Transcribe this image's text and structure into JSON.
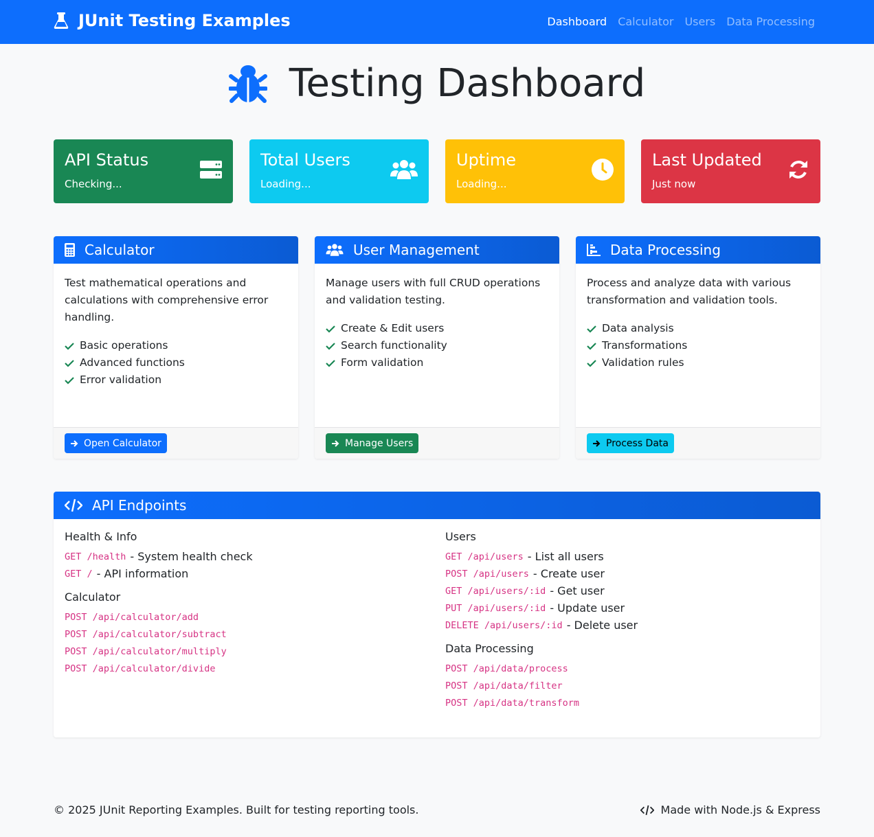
{
  "nav": {
    "brand": "JUnit Testing Examples",
    "links": [
      "Dashboard",
      "Calculator",
      "Users",
      "Data Processing"
    ]
  },
  "page": {
    "title": "Testing Dashboard"
  },
  "stats": [
    {
      "label": "API Status",
      "value": "Checking...",
      "icon": "server-icon",
      "color": "#198754"
    },
    {
      "label": "Total Users",
      "value": "Loading...",
      "icon": "users-icon",
      "color": "#0dcaf0"
    },
    {
      "label": "Uptime",
      "value": "Loading...",
      "icon": "clock-icon",
      "color": "#ffc107"
    },
    {
      "label": "Last Updated",
      "value": "Just now",
      "icon": "refresh-icon",
      "color": "#dc3545"
    }
  ],
  "cards": {
    "calculator": {
      "title": "Calculator",
      "description": "Test mathematical operations and calculations with comprehensive error handling.",
      "features": [
        "Basic operations",
        "Advanced functions",
        "Error validation"
      ],
      "button": "Open Calculator"
    },
    "users": {
      "title": "User Management",
      "description": "Manage users with full CRUD operations and validation testing.",
      "features": [
        "Create & Edit users",
        "Search functionality",
        "Form validation"
      ],
      "button": "Manage Users"
    },
    "data": {
      "title": "Data Processing",
      "description": "Process and analyze data with various transformation and validation tools.",
      "features": [
        "Data analysis",
        "Transformations",
        "Validation rules"
      ],
      "button": "Process Data"
    }
  },
  "endpoints": {
    "title": "API Endpoints",
    "health": {
      "heading": "Health & Info",
      "items": [
        {
          "route": "GET /health",
          "desc": "- System health check"
        },
        {
          "route": "GET /",
          "desc": "- API information"
        }
      ]
    },
    "calculator": {
      "heading": "Calculator",
      "items": [
        {
          "route": "POST /api/calculator/add"
        },
        {
          "route": "POST /api/calculator/subtract"
        },
        {
          "route": "POST /api/calculator/multiply"
        },
        {
          "route": "POST /api/calculator/divide"
        }
      ]
    },
    "users": {
      "heading": "Users",
      "items": [
        {
          "route": "GET /api/users",
          "desc": "- List all users"
        },
        {
          "route": "POST /api/users",
          "desc": "- Create user"
        },
        {
          "route": "GET /api/users/:id",
          "desc": "- Get user"
        },
        {
          "route": "PUT /api/users/:id",
          "desc": "- Update user"
        },
        {
          "route": "DELETE /api/users/:id",
          "desc": "- Delete user"
        }
      ]
    },
    "data": {
      "heading": "Data Processing",
      "items": [
        {
          "route": "POST /api/data/process"
        },
        {
          "route": "POST /api/data/filter"
        },
        {
          "route": "POST /api/data/transform"
        }
      ]
    }
  },
  "footer": {
    "copyright": "© 2025 JUnit Reporting Examples. Built for testing reporting tools.",
    "made_with": "Made with Node.js & Express"
  }
}
